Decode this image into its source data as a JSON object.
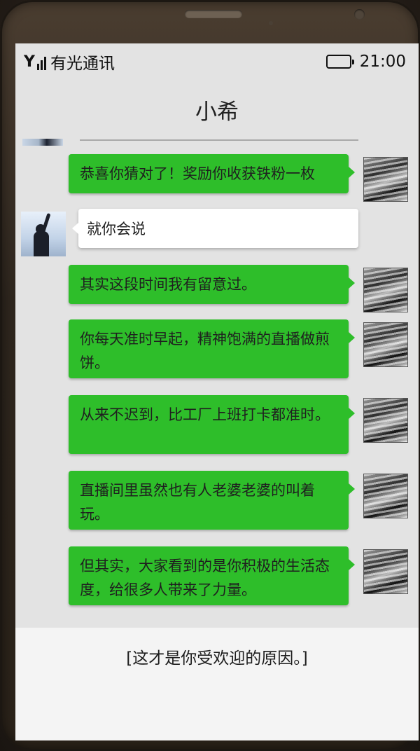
{
  "status_bar": {
    "carrier": "有光通讯",
    "time": "21:00",
    "signal_icon": "signal-icon",
    "battery_icon": "battery-icon"
  },
  "header": {
    "title": "小希"
  },
  "messages": [
    {
      "from": "me",
      "text": "恭喜你猜对了！奖励你收获铁粉一枚"
    },
    {
      "from": "other",
      "text": "就你会说"
    },
    {
      "from": "me",
      "text": "其实这段时间我有留意过。"
    },
    {
      "from": "me",
      "text": "你每天准时早起，精神饱满的直播做煎饼。"
    },
    {
      "from": "me",
      "text": "从来不迟到，比工厂上班打卡都准时。"
    },
    {
      "from": "me",
      "text": "直播间里虽然也有人老婆老婆的叫着玩。"
    },
    {
      "from": "me",
      "text": "但其实，大家看到的是你积极的生活态度，给很多人带来了力量。"
    }
  ],
  "narration": "[这才是你受欢迎的原因。]",
  "colors": {
    "bubble_out": "#2ebe2a",
    "bubble_in": "#ffffff",
    "screen_bg": "#e3e3e3",
    "bottom_panel": "#f4f4f4"
  }
}
